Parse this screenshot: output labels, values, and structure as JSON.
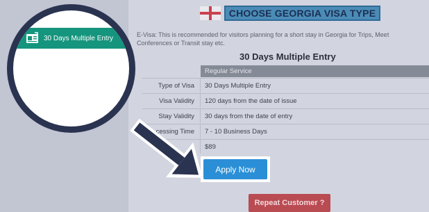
{
  "header": {
    "title": "CHOOSE GEORGIA VISA TYPE",
    "flag_icon": "georgia-flag-icon"
  },
  "intro": {
    "line1": "E-Visa: This is recommended for visitors planning for a short stay in Georgia for Trips, Meet",
    "line2": "Conferences or Transit stay etc."
  },
  "section": {
    "title": "30 Days Multiple Entry"
  },
  "table": {
    "header": "Regular Service",
    "rows": [
      {
        "label": "Type of Visa",
        "value": "30 Days Multiple Entry"
      },
      {
        "label": "Visa Validity",
        "value": "120 days from the date of issue"
      },
      {
        "label": "Stay Validity",
        "value": "30 days from the date of entry"
      },
      {
        "label": "cessing Time",
        "value": "7 - 10 Business Days"
      },
      {
        "label": "e",
        "value": "$89"
      }
    ]
  },
  "buttons": {
    "apply": "Apply Now",
    "repeat": "Repeat Customer ?"
  },
  "magnifier": {
    "menu_label": "30 Days Multiple Entry",
    "menu_icon": "visa-document-icon"
  },
  "colors": {
    "accent_teal": "#15957d",
    "apply_blue": "#2a8fd6",
    "repeat_red": "#b94b52",
    "ring_navy": "#2a3350"
  }
}
